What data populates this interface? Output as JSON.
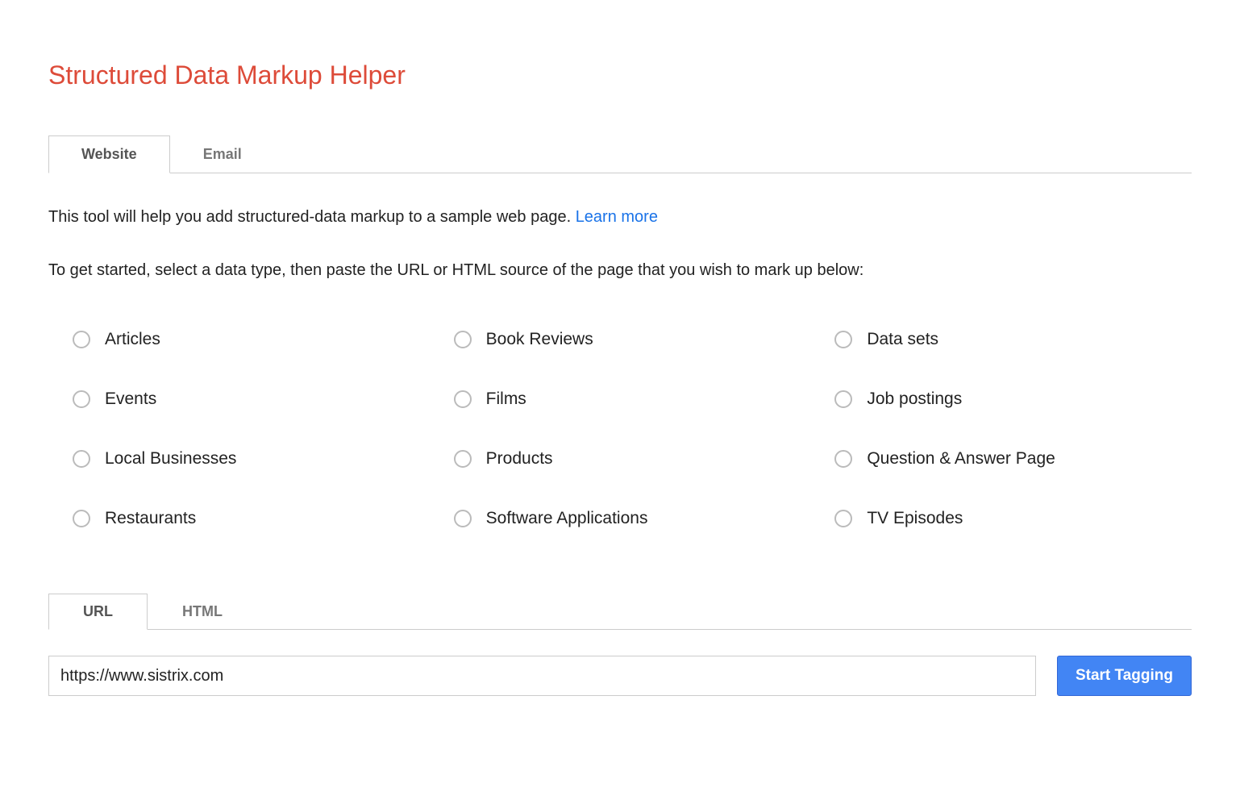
{
  "header": {
    "title": "Structured Data Markup Helper"
  },
  "tabs": {
    "website": "Website",
    "email": "Email"
  },
  "intro": {
    "text": "This tool will help you add structured-data markup to a sample web page. ",
    "learn_more": "Learn more"
  },
  "subtext": "To get started, select a data type, then paste the URL or HTML source of the page that you wish to mark up below:",
  "data_types": {
    "articles": "Articles",
    "book_reviews": "Book Reviews",
    "data_sets": "Data sets",
    "events": "Events",
    "films": "Films",
    "job_postings": "Job postings",
    "local_businesses": "Local Businesses",
    "products": "Products",
    "qa_page": "Question & Answer Page",
    "restaurants": "Restaurants",
    "software_apps": "Software Applications",
    "tv_episodes": "TV Episodes"
  },
  "input_tabs": {
    "url": "URL",
    "html": "HTML"
  },
  "input": {
    "url_value": "https://www.sistrix.com"
  },
  "button": {
    "start_tagging": "Start Tagging"
  }
}
